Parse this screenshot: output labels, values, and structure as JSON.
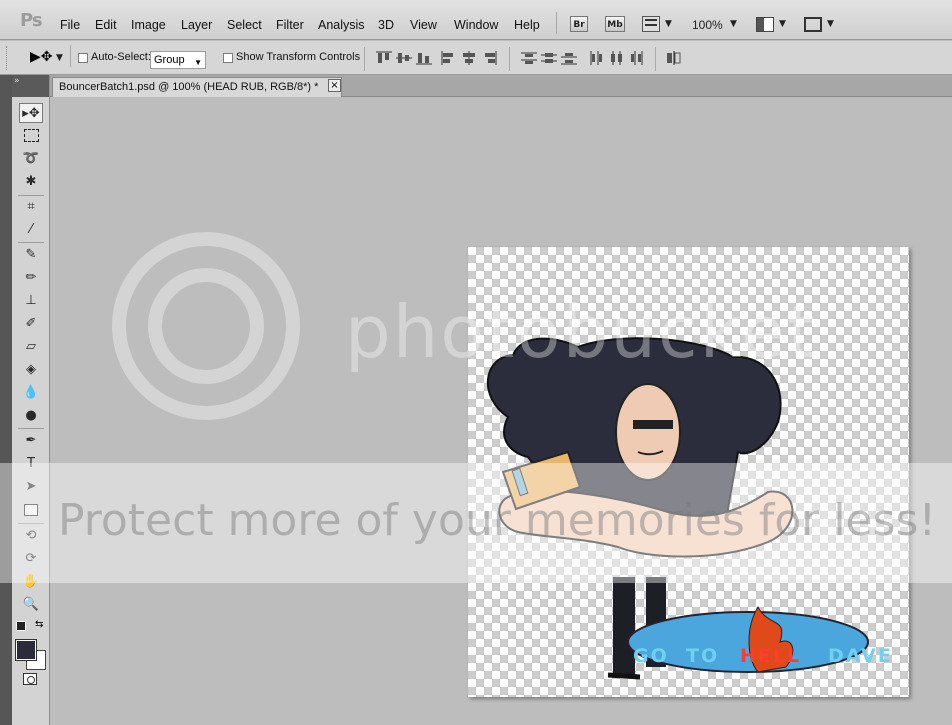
{
  "app": {
    "logo": "Ps"
  },
  "menu": [
    "File",
    "Edit",
    "Image",
    "Layer",
    "Select",
    "Filter",
    "Analysis",
    "3D",
    "View",
    "Window",
    "Help"
  ],
  "menubar_right": {
    "bridge": "Br",
    "mini_bridge": "Mb",
    "zoom": "100%"
  },
  "options": {
    "auto_select_label": "Auto-Select:",
    "auto_select_value": "Group",
    "transform_label": "Show Transform Controls"
  },
  "document": {
    "tab_title": "BouncerBatch1.psd @ 100% (HEAD RUB, RGB/8*) *",
    "close": "×"
  },
  "artwork": {
    "logo_words": [
      "GO",
      "TO",
      "HELL",
      "DAVE"
    ]
  },
  "watermark": {
    "brand": "photobucket",
    "banner": "Protect more of your memories for less!"
  },
  "colors": {
    "foreground": "#2b2b3a",
    "background": "#ffffff"
  }
}
